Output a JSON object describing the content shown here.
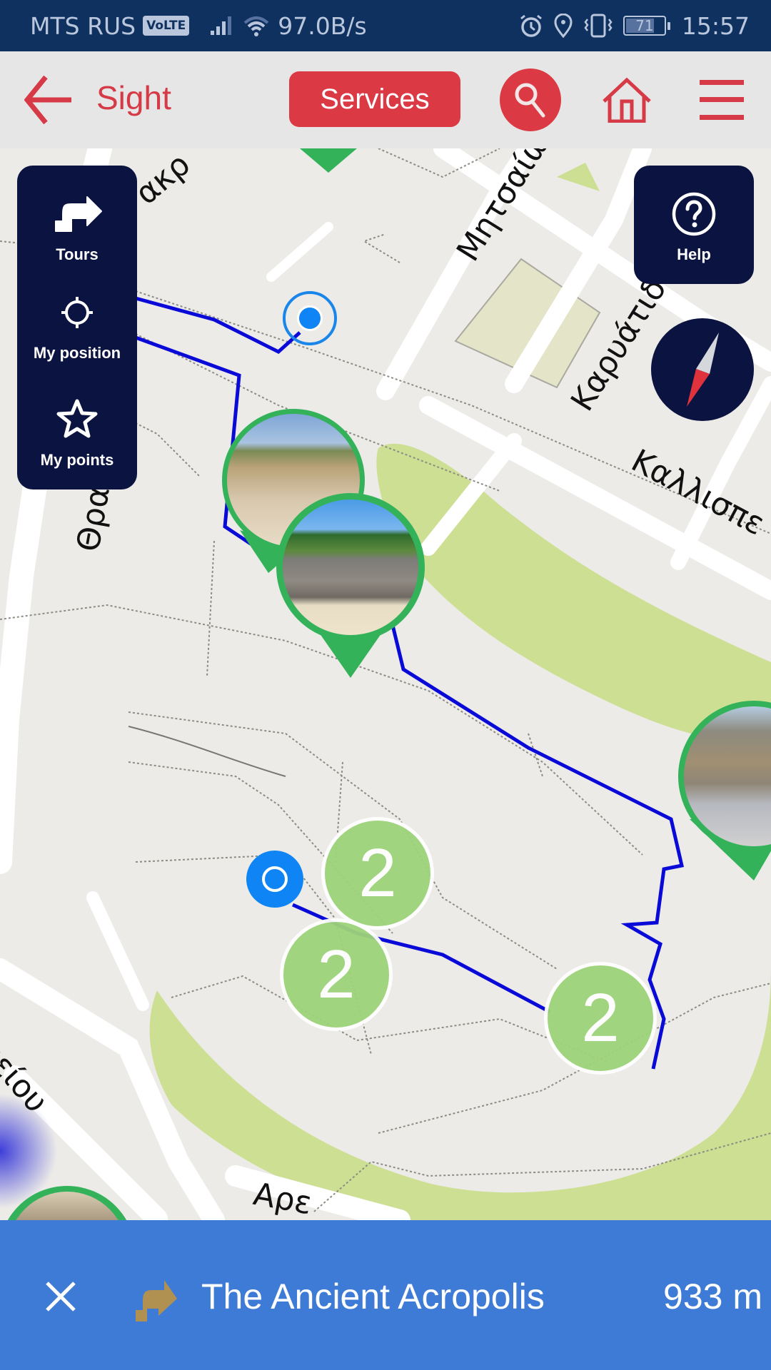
{
  "status_bar": {
    "carrier": "MTS RUS",
    "volte": "VoLTE",
    "net_speed": "97.0B/s",
    "battery": "71",
    "time": "15:57"
  },
  "app_bar": {
    "title": "Sight",
    "services_label": "Services"
  },
  "side_panel": {
    "items": [
      {
        "label": "Tours",
        "icon": "tours-icon"
      },
      {
        "label": "My position",
        "icon": "crosshair-icon"
      },
      {
        "label": "My points",
        "icon": "star-icon"
      }
    ]
  },
  "help": {
    "label": "Help"
  },
  "map": {
    "street_labels": [
      "Μητσαίω",
      "Καρυάτιδ",
      "Καλλισπε",
      "Θρα",
      "ακρ",
      "ανείου",
      "Αρε"
    ],
    "clusters": [
      {
        "count": "2"
      },
      {
        "count": "2"
      },
      {
        "count": "2"
      }
    ]
  },
  "bottom_bar": {
    "tour_name": "The Ancient Acropolis",
    "distance": "933 m"
  },
  "colors": {
    "accent_red": "#db3a45",
    "panel_navy": "#0b1440",
    "route_blue": "#0a0ad8",
    "poi_green": "#34b25a",
    "bottom_blue": "#3e7bd6"
  }
}
